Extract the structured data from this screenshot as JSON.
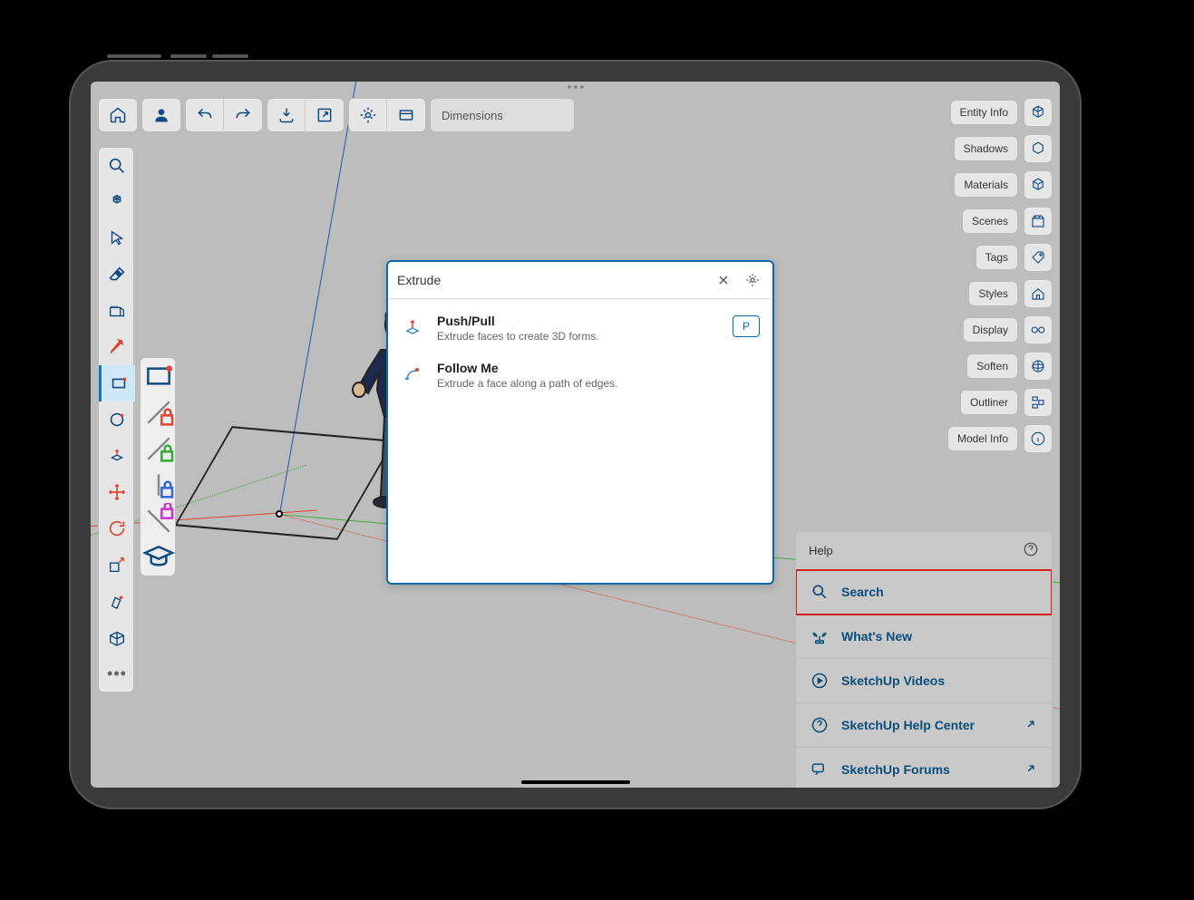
{
  "top_toolbar": {
    "home": "home",
    "user": "user",
    "undo": "undo",
    "redo": "redo",
    "import": "import",
    "export": "export",
    "settings": "settings",
    "save": "save"
  },
  "dimensions_placeholder": "Dimensions",
  "left_toolbar": {
    "search": "search",
    "orbit": "orbit",
    "select": "select",
    "eraser": "eraser",
    "tape": "tape",
    "line": "line",
    "rectangle": "rectangle",
    "circle": "circle",
    "pushpull": "pushpull",
    "move": "move",
    "rotate": "rotate",
    "scale": "scale",
    "paint": "paint",
    "view": "view",
    "more": "..."
  },
  "right_panels": [
    {
      "label": "Entity Info",
      "icon": "cube"
    },
    {
      "label": "Shadows",
      "icon": "cube-outline"
    },
    {
      "label": "Materials",
      "icon": "package"
    },
    {
      "label": "Scenes",
      "icon": "clapper"
    },
    {
      "label": "Tags",
      "icon": "tag"
    },
    {
      "label": "Styles",
      "icon": "house"
    },
    {
      "label": "Display",
      "icon": "glasses"
    },
    {
      "label": "Soften",
      "icon": "sphere"
    },
    {
      "label": "Outliner",
      "icon": "outliner"
    },
    {
      "label": "Model Info",
      "icon": "info"
    }
  ],
  "search_dialog": {
    "input_value": "Extrude",
    "results": [
      {
        "title": "Push/Pull",
        "desc": "Extrude faces to create 3D forms.",
        "shortcut": "P",
        "icon": "pushpull"
      },
      {
        "title": "Follow Me",
        "desc": "Extrude a face along a path of edges.",
        "shortcut": "",
        "icon": "followme"
      }
    ]
  },
  "help_panel": {
    "title": "Help",
    "items": [
      {
        "text": "Search",
        "icon": "search",
        "highlighted": true,
        "external": false
      },
      {
        "text": "What's New",
        "icon": "plant",
        "highlighted": false,
        "external": false
      },
      {
        "text": "SketchUp Videos",
        "icon": "play",
        "highlighted": false,
        "external": false
      },
      {
        "text": "SketchUp Help Center",
        "icon": "help",
        "highlighted": false,
        "external": true
      },
      {
        "text": "SketchUp Forums",
        "icon": "forum",
        "highlighted": false,
        "external": true
      }
    ]
  }
}
